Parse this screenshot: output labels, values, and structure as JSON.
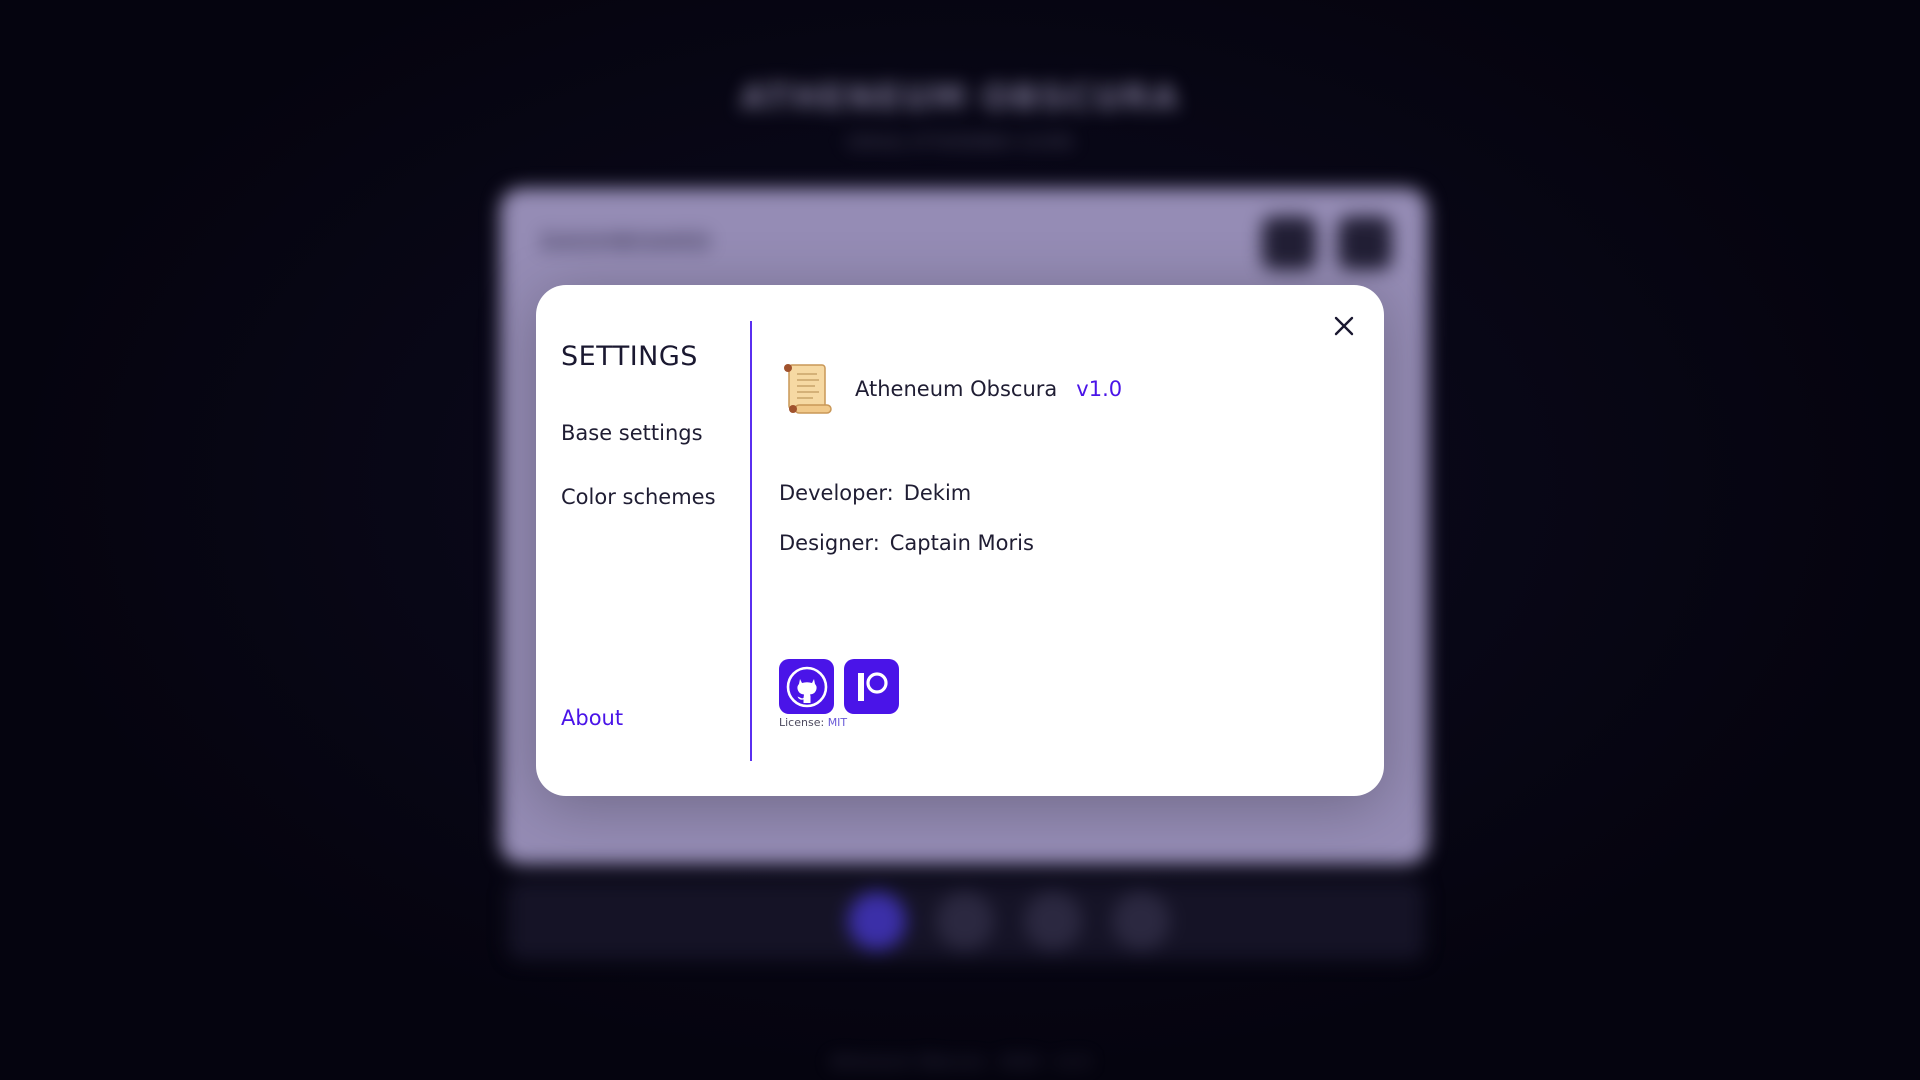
{
  "background": {
    "title": "ATHENEUM OBSCURA",
    "subtitle": "Library of forbidden scrolls",
    "card_label": "DASHBOARD",
    "footer": "Atheneum Obscura · 2024 · v1.0"
  },
  "settings": {
    "title": "SETTINGS",
    "nav": [
      {
        "label": "Base settings",
        "active": false
      },
      {
        "label": "Color schemes",
        "active": false
      },
      {
        "label": "About",
        "active": true
      }
    ],
    "close_icon": "close-icon"
  },
  "about": {
    "app_icon": "scroll-icon",
    "app_name": "Atheneum Obscura",
    "version": "v1.0",
    "developer_label": "Developer:",
    "developer": "Dekim",
    "designer_label": "Designer:",
    "designer": "Captain Moris",
    "social": [
      {
        "name": "github",
        "icon": "github-icon"
      },
      {
        "name": "patreon",
        "icon": "patreon-icon"
      }
    ],
    "license_label": "License:",
    "license": "MIT"
  },
  "colors": {
    "accent": "#4a14e8",
    "modal_bg": "#ffffff",
    "backdrop": "#05040f",
    "card_bg": "#958cb5"
  }
}
